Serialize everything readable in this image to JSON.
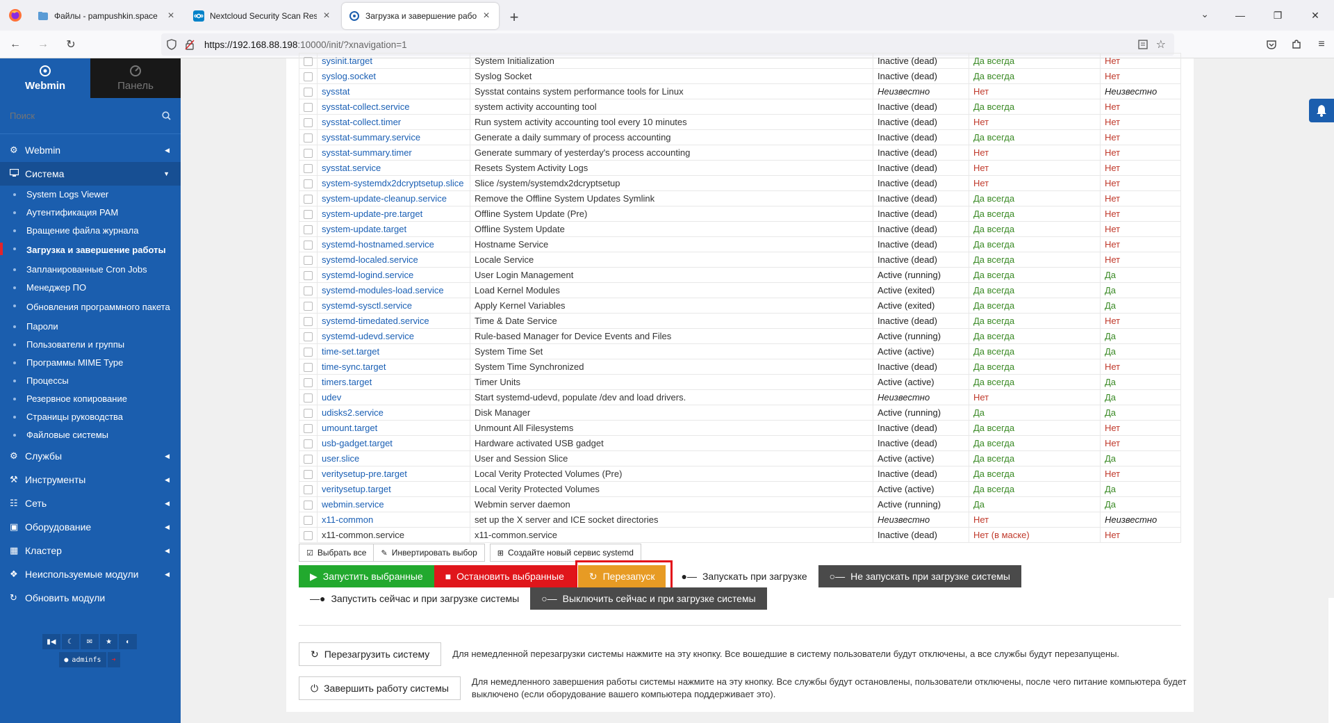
{
  "browser": {
    "tabs": [
      {
        "title": "Файлы - pampushkin.space",
        "active": false
      },
      {
        "title": "Nextcloud Security Scan Results",
        "active": false
      },
      {
        "title": "Загрузка и завершение работы",
        "active": true
      }
    ],
    "url_host": "https://192.168.88.198",
    "url_rest": ":10000/init/?xnavigation=1"
  },
  "sidebar": {
    "webmin_label": "Webmin",
    "panel_label": "Панель",
    "search_placeholder": "Поиск",
    "sections_top": [
      {
        "label": "Webmin"
      }
    ],
    "open_section": "Система",
    "sub_items": [
      {
        "label": "System Logs Viewer"
      },
      {
        "label": "Аутентификация PAM"
      },
      {
        "label": "Вращение файла журнала"
      },
      {
        "label": "Загрузка и завершение работы",
        "active": true
      },
      {
        "label": "Запланированные Cron Jobs"
      },
      {
        "label": "Менеджер ПО"
      },
      {
        "label": "Обновления программного пакета"
      },
      {
        "label": "Пароли"
      },
      {
        "label": "Пользователи и группы"
      },
      {
        "label": "Программы MIME Type"
      },
      {
        "label": "Процессы"
      },
      {
        "label": "Резервное копирование"
      },
      {
        "label": "Страницы руководства"
      },
      {
        "label": "Файловые системы"
      }
    ],
    "sections_bottom": [
      {
        "label": "Службы",
        "icon": "cogs-icon"
      },
      {
        "label": "Инструменты",
        "icon": "wrench-icon"
      },
      {
        "label": "Сеть",
        "icon": "network-icon"
      },
      {
        "label": "Оборудование",
        "icon": "hardware-icon"
      },
      {
        "label": "Кластер",
        "icon": "cluster-icon"
      },
      {
        "label": "Неиспользуемые модули",
        "icon": "puzzle-icon"
      },
      {
        "label": "Обновить модули",
        "icon": "refresh-icon"
      }
    ],
    "user": "adminfs"
  },
  "services": [
    {
      "name": "sysinit.target",
      "desc": "System Initialization",
      "status": "Inactive (dead)",
      "boot": "Да всегда",
      "running": "Нет"
    },
    {
      "name": "syslog.socket",
      "desc": "Syslog Socket",
      "status": "Inactive (dead)",
      "boot": "Да всегда",
      "running": "Нет"
    },
    {
      "name": "sysstat",
      "desc": "Sysstat contains system performance tools for Linux",
      "status": "Неизвестно",
      "boot": "Нет",
      "running": "Неизвестно"
    },
    {
      "name": "sysstat-collect.service",
      "desc": "system activity accounting tool",
      "status": "Inactive (dead)",
      "boot": "Да всегда",
      "running": "Нет"
    },
    {
      "name": "sysstat-collect.timer",
      "desc": "Run system activity accounting tool every 10 minutes",
      "status": "Inactive (dead)",
      "boot": "Нет",
      "running": "Нет"
    },
    {
      "name": "sysstat-summary.service",
      "desc": "Generate a daily summary of process accounting",
      "status": "Inactive (dead)",
      "boot": "Да всегда",
      "running": "Нет"
    },
    {
      "name": "sysstat-summary.timer",
      "desc": "Generate summary of yesterday's process accounting",
      "status": "Inactive (dead)",
      "boot": "Нет",
      "running": "Нет"
    },
    {
      "name": "sysstat.service",
      "desc": "Resets System Activity Logs",
      "status": "Inactive (dead)",
      "boot": "Нет",
      "running": "Нет"
    },
    {
      "name": "system-systemdx2dcryptsetup.slice",
      "desc": "Slice /system/systemdx2dcryptsetup",
      "status": "Inactive (dead)",
      "boot": "Нет",
      "running": "Нет"
    },
    {
      "name": "system-update-cleanup.service",
      "desc": "Remove the Offline System Updates Symlink",
      "status": "Inactive (dead)",
      "boot": "Да всегда",
      "running": "Нет"
    },
    {
      "name": "system-update-pre.target",
      "desc": "Offline System Update (Pre)",
      "status": "Inactive (dead)",
      "boot": "Да всегда",
      "running": "Нет"
    },
    {
      "name": "system-update.target",
      "desc": "Offline System Update",
      "status": "Inactive (dead)",
      "boot": "Да всегда",
      "running": "Нет"
    },
    {
      "name": "systemd-hostnamed.service",
      "desc": "Hostname Service",
      "status": "Inactive (dead)",
      "boot": "Да всегда",
      "running": "Нет"
    },
    {
      "name": "systemd-localed.service",
      "desc": "Locale Service",
      "status": "Inactive (dead)",
      "boot": "Да всегда",
      "running": "Нет"
    },
    {
      "name": "systemd-logind.service",
      "desc": "User Login Management",
      "status": "Active (running)",
      "boot": "Да всегда",
      "running": "Да"
    },
    {
      "name": "systemd-modules-load.service",
      "desc": "Load Kernel Modules",
      "status": "Active (exited)",
      "boot": "Да всегда",
      "running": "Да"
    },
    {
      "name": "systemd-sysctl.service",
      "desc": "Apply Kernel Variables",
      "status": "Active (exited)",
      "boot": "Да всегда",
      "running": "Да"
    },
    {
      "name": "systemd-timedated.service",
      "desc": "Time & Date Service",
      "status": "Inactive (dead)",
      "boot": "Да всегда",
      "running": "Нет"
    },
    {
      "name": "systemd-udevd.service",
      "desc": "Rule-based Manager for Device Events and Files",
      "status": "Active (running)",
      "boot": "Да всегда",
      "running": "Да"
    },
    {
      "name": "time-set.target",
      "desc": "System Time Set",
      "status": "Active (active)",
      "boot": "Да всегда",
      "running": "Да"
    },
    {
      "name": "time-sync.target",
      "desc": "System Time Synchronized",
      "status": "Inactive (dead)",
      "boot": "Да всегда",
      "running": "Нет"
    },
    {
      "name": "timers.target",
      "desc": "Timer Units",
      "status": "Active (active)",
      "boot": "Да всегда",
      "running": "Да"
    },
    {
      "name": "udev",
      "desc": "Start systemd-udevd, populate /dev and load drivers.",
      "status": "Неизвестно",
      "boot": "Нет",
      "running": "Да"
    },
    {
      "name": "udisks2.service",
      "desc": "Disk Manager",
      "status": "Active (running)",
      "boot": "Да",
      "running": "Да"
    },
    {
      "name": "umount.target",
      "desc": "Unmount All Filesystems",
      "status": "Inactive (dead)",
      "boot": "Да всегда",
      "running": "Нет"
    },
    {
      "name": "usb-gadget.target",
      "desc": "Hardware activated USB gadget",
      "status": "Inactive (dead)",
      "boot": "Да всегда",
      "running": "Нет"
    },
    {
      "name": "user.slice",
      "desc": "User and Session Slice",
      "status": "Active (active)",
      "boot": "Да всегда",
      "running": "Да"
    },
    {
      "name": "veritysetup-pre.target",
      "desc": "Local Verity Protected Volumes (Pre)",
      "status": "Inactive (dead)",
      "boot": "Да всегда",
      "running": "Нет"
    },
    {
      "name": "veritysetup.target",
      "desc": "Local Verity Protected Volumes",
      "status": "Active (active)",
      "boot": "Да всегда",
      "running": "Да"
    },
    {
      "name": "webmin.service",
      "desc": "Webmin server daemon",
      "status": "Active (running)",
      "boot": "Да",
      "running": "Да"
    },
    {
      "name": "x11-common",
      "desc": "set up the X server and ICE socket directories",
      "status": "Неизвестно",
      "boot": "Нет",
      "running": "Неизвестно"
    },
    {
      "name": "x11-common.service",
      "desc": "x11-common.service",
      "status": "Inactive (dead)",
      "boot": "Нет (в маске)",
      "running": "Нет",
      "nolink": true
    }
  ],
  "selection": {
    "select_all": "Выбрать все",
    "invert": "Инвертировать выбор",
    "create": "Создайте новый сервис systemd"
  },
  "actions": {
    "start": "Запустить выбранные",
    "stop": "Остановить выбранные",
    "restart": "Перезапуск",
    "enable_boot": "Запускать при загрузке",
    "disable_boot": "Не запускать при загрузке системы",
    "start_and_enable": "Запустить сейчас и при загрузке системы",
    "stop_and_disable": "Выключить сейчас и при загрузке системы"
  },
  "system": {
    "reboot_label": "Перезагрузить систему",
    "reboot_desc": "Для немедленной перезагрузки системы нажмите на эту кнопку. Все вошедшие в систему пользователи будут отключены, а все службы будут перезапущены.",
    "shutdown_label": "Завершить работу системы",
    "shutdown_desc_1": "Для немедленного завершения работы системы нажмите на эту кнопку. Все службы будут остановлены, пользователи отключены, после чего питание компьютера будет",
    "shutdown_desc_2": "выключено (если оборудование вашего компьютера поддерживает это)."
  },
  "colors": {
    "sidebar": "#1b5eae",
    "green": "#22a92e",
    "red": "#e0161b",
    "orange": "#e79b24",
    "dark": "#4a4a4a",
    "highlight": "#e3121a"
  }
}
